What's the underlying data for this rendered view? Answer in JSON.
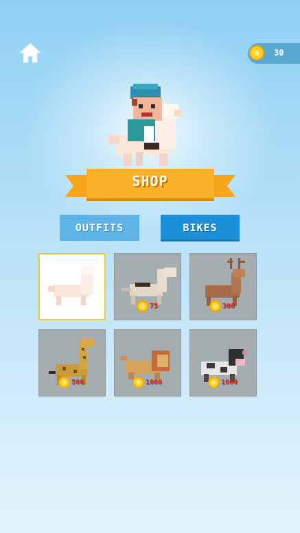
{
  "coins": "30",
  "banner_title": "SHOP",
  "tabs": {
    "outfits": "OUTFITS",
    "bikes": "BIKES",
    "active": "bikes"
  },
  "items": [
    {
      "animal": "llama",
      "selected": true,
      "price": ""
    },
    {
      "animal": "horse",
      "selected": false,
      "price": "75"
    },
    {
      "animal": "deer",
      "selected": false,
      "price": "300"
    },
    {
      "animal": "giraffe",
      "selected": false,
      "price": "500"
    },
    {
      "animal": "lion",
      "selected": false,
      "price": "1000"
    },
    {
      "animal": "cow",
      "selected": false,
      "price": "1000"
    }
  ],
  "colors": {
    "banner": "#f9b227",
    "tab_active": "#1c8fd9",
    "tab_inactive": "#5eb4e6",
    "price": "#e52a14",
    "coin": "#ffcf1f"
  },
  "icons": [
    "home-icon",
    "coin-icon"
  ]
}
